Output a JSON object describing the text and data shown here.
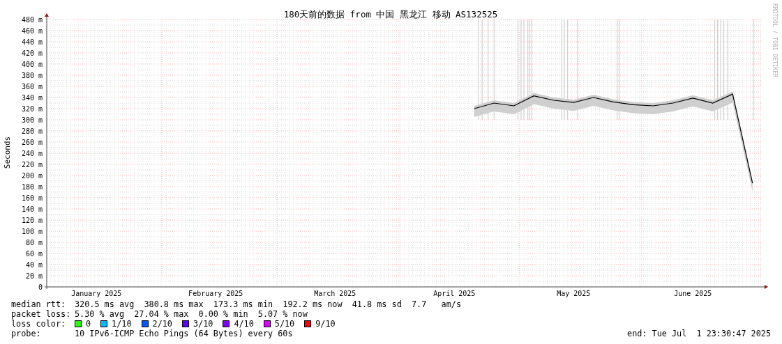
{
  "graph": {
    "credit": "RRDTOOL / TOBI OETIKER",
    "chart_data": {
      "type": "line",
      "title": "180天前的数据 from 中国 黑龙江 移动 AS132525",
      "ylabel": "Seconds",
      "ylim": [
        0,
        480
      ],
      "grid": true,
      "categories": [
        null,
        null,
        "January 2025",
        null,
        null,
        null,
        null,
        null,
        "February 2025",
        null,
        null,
        null,
        null,
        null,
        "March 2025",
        null,
        null,
        null,
        null,
        null,
        "April 2025",
        null,
        null,
        null,
        null,
        null,
        "May 2025",
        null,
        null,
        null,
        null,
        null,
        "June 2025",
        null,
        null,
        null
      ],
      "series": [
        {
          "color": "#000000",
          "values": [
            null,
            null,
            null,
            null,
            null,
            null,
            null,
            null,
            null,
            null,
            null,
            null,
            null,
            null,
            null,
            null,
            null,
            null,
            null,
            null,
            null,
            320,
            330,
            325,
            343,
            335,
            331,
            340,
            332,
            327,
            325,
            330,
            339,
            330,
            346,
            186
          ]
        }
      ],
      "yticks": [
        {
          "value": 0,
          "label": "0"
        },
        {
          "value": 20,
          "label": "20 m"
        },
        {
          "value": 40,
          "label": "40 m"
        },
        {
          "value": 60,
          "label": "60 m"
        },
        {
          "value": 80,
          "label": "80 m"
        },
        {
          "value": 100,
          "label": "100 m"
        },
        {
          "value": 120,
          "label": "120 m"
        },
        {
          "value": 140,
          "label": "140 m"
        },
        {
          "value": 160,
          "label": "160 m"
        },
        {
          "value": 180,
          "label": "180 m"
        },
        {
          "value": 200,
          "label": "200 m"
        },
        {
          "value": 220,
          "label": "220 m"
        },
        {
          "value": 240,
          "label": "240 m"
        },
        {
          "value": 260,
          "label": "260 m"
        },
        {
          "value": 280,
          "label": "280 m"
        },
        {
          "value": 300,
          "label": "300 m"
        },
        {
          "value": 320,
          "label": "320 m"
        },
        {
          "value": 340,
          "label": "340 m"
        },
        {
          "value": 360,
          "label": "360 m"
        },
        {
          "value": 380,
          "label": "380 m"
        },
        {
          "value": 400,
          "label": "400 m"
        },
        {
          "value": 420,
          "label": "420 m"
        },
        {
          "value": 440,
          "label": "440 m"
        },
        {
          "value": 460,
          "label": "460 m"
        },
        {
          "value": 480,
          "label": "480 m"
        }
      ]
    }
  },
  "stats": [
    {
      "label": "median rtt:",
      "text": "320.5 ms avg  380.8 ms max  173.3 ms min  192.2 ms now  41.8 ms sd  7.7   am/s"
    },
    {
      "label": "packet loss:",
      "text": "5.30 % avg  27.04 % max  0.00 % min  5.07 % now"
    }
  ],
  "loss_color": {
    "label": "loss color:",
    "items": [
      {
        "label": "0",
        "color": "#26ff00"
      },
      {
        "label": "1/10",
        "color": "#00b8ff"
      },
      {
        "label": "2/10",
        "color": "#0059ff"
      },
      {
        "label": "3/10",
        "color": "#5e00ff"
      },
      {
        "label": "4/10",
        "color": "#7e00ff"
      },
      {
        "label": "5/10",
        "color": "#dd00ff"
      },
      {
        "label": "9/10",
        "color": "#ff0000"
      }
    ]
  },
  "probe": {
    "label": "probe:",
    "text": "10 IPv6-ICMP Echo Pings (64 Bytes) every 60s",
    "end": "end: Tue Jul  1 23:30:47 2025"
  }
}
